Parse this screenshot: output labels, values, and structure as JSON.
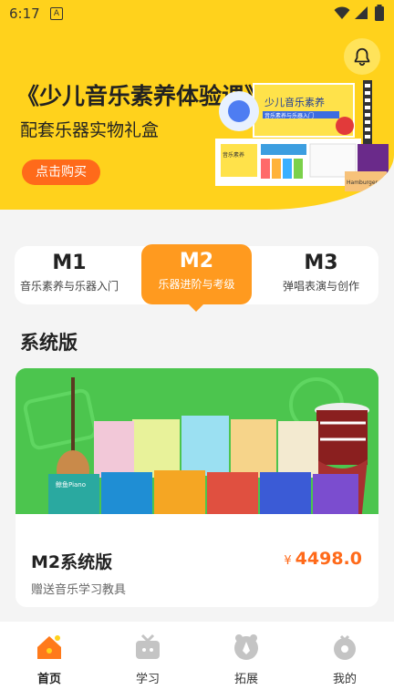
{
  "status_bar": {
    "time": "6:17",
    "notification_badge": "A"
  },
  "banner": {
    "title": "《少儿音乐素养体验课》",
    "subtitle": "配套乐器实物礼盒",
    "buy_label": "点击购买",
    "box_title": "少儿音乐素养",
    "box_subtitle": "音乐素养与乐器入门",
    "product_card_label": "音乐素养",
    "hamburger_label": "Hamburger",
    "colors": {
      "background": "#ffd21c",
      "button": "#ff6a1a"
    }
  },
  "level_tabs": [
    {
      "code": "M1",
      "desc": "音乐素养与乐器入门",
      "active": false
    },
    {
      "code": "M2",
      "desc": "乐器进阶与考级",
      "active": true
    },
    {
      "code": "M3",
      "desc": "弹唱表演与创作",
      "active": false
    }
  ],
  "section": {
    "title": "系统版"
  },
  "product": {
    "name": "M2系统版",
    "currency": "¥",
    "price": "4498.0",
    "gift": "赠送音乐学习教具",
    "book_label": "鲸鱼Piano"
  },
  "bottom_nav": [
    {
      "label": "首页",
      "icon": "home-icon",
      "active": true
    },
    {
      "label": "学习",
      "icon": "tv-icon",
      "active": false
    },
    {
      "label": "拓展",
      "icon": "extend-icon",
      "active": false
    },
    {
      "label": "我的",
      "icon": "profile-icon",
      "active": false
    }
  ],
  "colors": {
    "accent": "#ff9a1f",
    "price": "#ff6a1a",
    "card_green": "#4cc54e"
  }
}
